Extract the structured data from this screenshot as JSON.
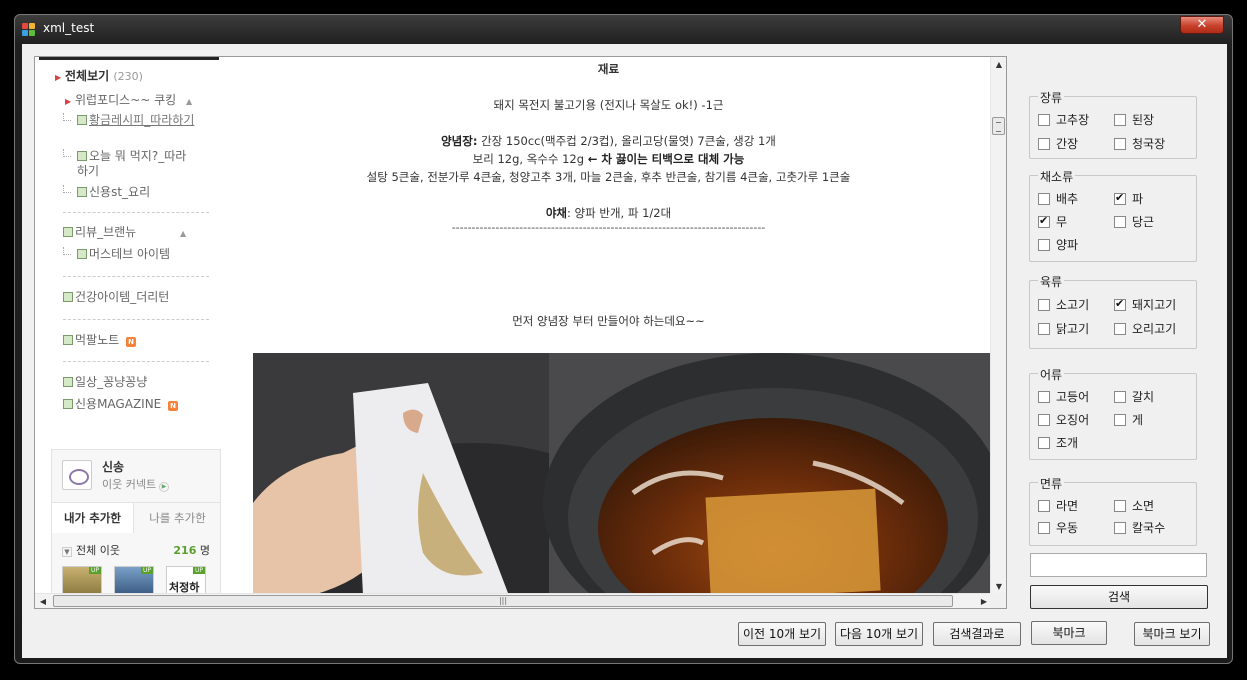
{
  "window": {
    "title": "xml_test",
    "close_glyph": "✕"
  },
  "sidebar": {
    "all_label": "전체보기",
    "all_count": "(230)",
    "categories": [
      {
        "label": "위럽포디스~~ 쿠킹"
      },
      {
        "label": "황금레시피_따라하기"
      },
      {
        "label": "오늘 뭐 먹지?_따라하기"
      },
      {
        "label": "신용st_요리"
      },
      {
        "label": "리뷰_브랜뉴"
      },
      {
        "label": "머스테브 아이템"
      },
      {
        "label": "건강아이템_더리턴"
      },
      {
        "label": "먹팔노트"
      },
      {
        "label": "일상_꽁냥꽁냥"
      },
      {
        "label": "신용MAGAZINE"
      }
    ],
    "new_badge": "N",
    "profile": {
      "name": "신송",
      "link": "이웃 커넥트",
      "tab_mine": "내가 추가한",
      "tab_others": "나를 추가한",
      "neighbors_label": "전체 이웃",
      "neighbors_count": "216",
      "neighbors_unit": "명",
      "thumb_badge": "UP",
      "thumb3_text": "처정하"
    }
  },
  "post": {
    "heading": "재료",
    "line1": "돼지 목전지 불고기용 (전지나 목살도 ok!) -1근",
    "line2_bold": "양념장:",
    "line2": " 간장 150cc(맥주컵 2/3컵), 올리고당(물엿) 7큰술, 생강 1개",
    "line3": "보리 12g, 옥수수 12g ",
    "line3_bold": "← 차 끓이는 티백으로 대체 가능",
    "line4": "설탕 5큰술, 전분가루 4큰술, 청양고추 3개, 마늘 2큰술, 후추 반큰술, 참기름 4큰술, 고춧가루 1큰술",
    "line5_bold": "야채",
    "line5": ": 양파 반개, 파 1/2대",
    "divider": "-------------------------------------------------------------------------------",
    "line6": "먼저 양념장 부터 만들어야 하는데요~~"
  },
  "filters": {
    "sauce": {
      "title": "장류",
      "items": [
        {
          "label": "고추장",
          "checked": false
        },
        {
          "label": "된장",
          "checked": false
        },
        {
          "label": "간장",
          "checked": false
        },
        {
          "label": "청국장",
          "checked": false
        }
      ]
    },
    "veg": {
      "title": "채소류",
      "items": [
        {
          "label": "배추",
          "checked": false
        },
        {
          "label": "파",
          "checked": true
        },
        {
          "label": "무",
          "checked": true
        },
        {
          "label": "당근",
          "checked": false
        },
        {
          "label": "양파",
          "checked": false
        }
      ]
    },
    "meat": {
      "title": "육류",
      "items": [
        {
          "label": "소고기",
          "checked": false
        },
        {
          "label": "돼지고기",
          "checked": true
        },
        {
          "label": "닭고기",
          "checked": false
        },
        {
          "label": "오리고기",
          "checked": false
        }
      ]
    },
    "fish": {
      "title": "어류",
      "items": [
        {
          "label": "고등어",
          "checked": false
        },
        {
          "label": "갈치",
          "checked": false
        },
        {
          "label": "오징어",
          "checked": false
        },
        {
          "label": "게",
          "checked": false
        },
        {
          "label": "조개",
          "checked": false
        }
      ]
    },
    "noodle": {
      "title": "면류",
      "items": [
        {
          "label": "라면",
          "checked": false
        },
        {
          "label": "소면",
          "checked": false
        },
        {
          "label": "우동",
          "checked": false
        },
        {
          "label": "칼국수",
          "checked": false
        }
      ]
    }
  },
  "search": {
    "value": "",
    "button": "검색"
  },
  "buttons": {
    "prev": "이전 10개 보기",
    "next": "다음 10개 보기",
    "to_results": "검색결과로",
    "bookmark": "북마크",
    "view_bookmarks": "북마크 보기"
  }
}
